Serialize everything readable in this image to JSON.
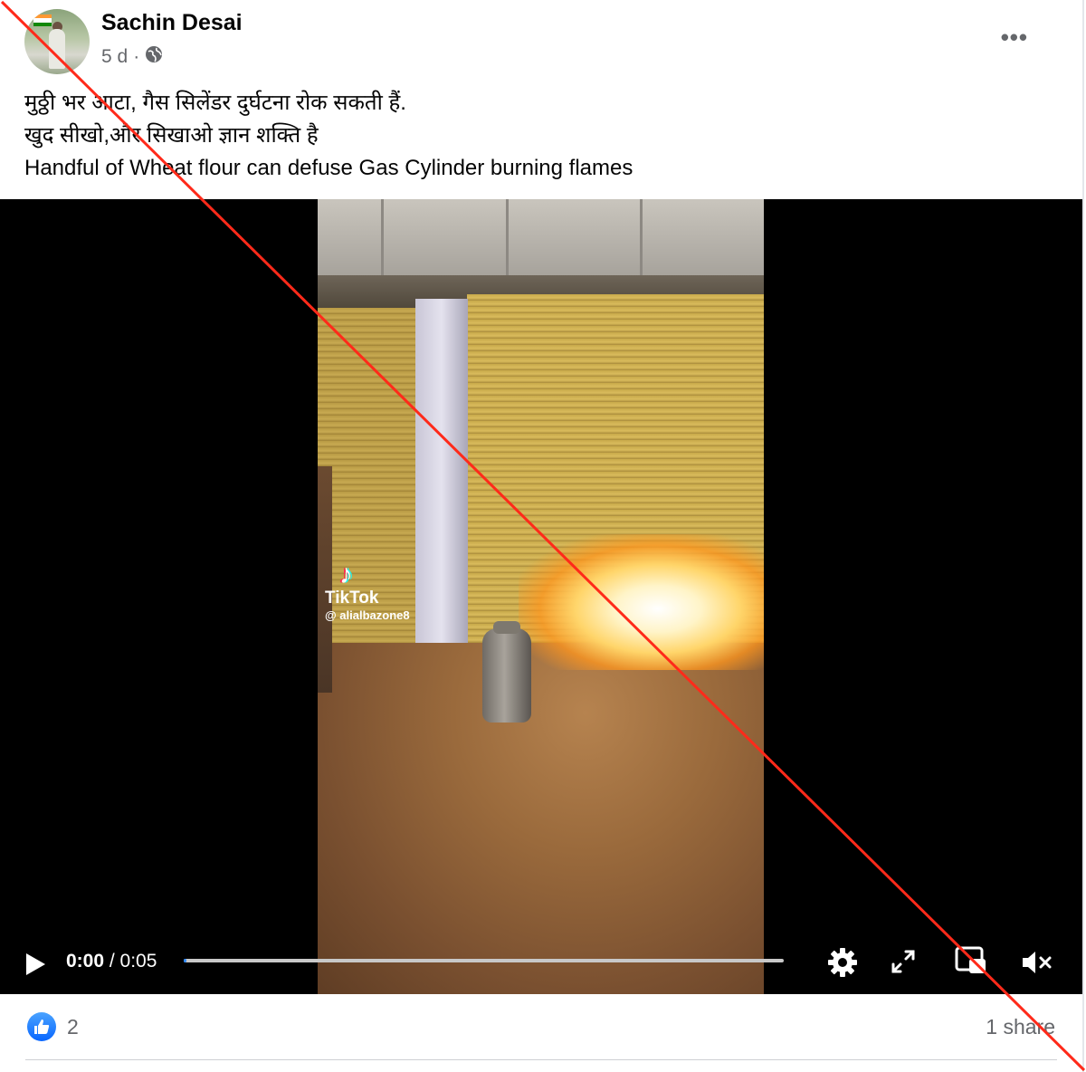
{
  "post": {
    "author": "Sachin Desai",
    "timestamp": "5 d",
    "separator": "·",
    "privacy_icon": "globe-icon",
    "more_label": "•••",
    "caption_lines": [
      "मुठ्ठी भर आटा, गैस सिलेंडर दुर्घटना रोक सकती हैं.",
      "खुद सीखो,और सिखाओ ज्ञान शक्ति है",
      "Handful of Wheat flour can defuse Gas Cylinder burning flames"
    ]
  },
  "video": {
    "watermark_brand": "TikTok",
    "watermark_handle": "@ alialbazone8",
    "current_time": "0:00",
    "time_separator": " / ",
    "duration": "0:05",
    "progress_fraction": 0.0,
    "controls": [
      "play-icon",
      "gear-icon",
      "fullscreen-icon",
      "miniplayer-icon",
      "muted-volume-icon"
    ]
  },
  "engagement": {
    "reaction_icon": "like-icon",
    "reaction_count": "2",
    "shares_label": "1 share"
  },
  "colors": {
    "facebook_blue": "#0866ff",
    "secondary_text": "#65676b",
    "strike_line": "#ff2a1a"
  }
}
